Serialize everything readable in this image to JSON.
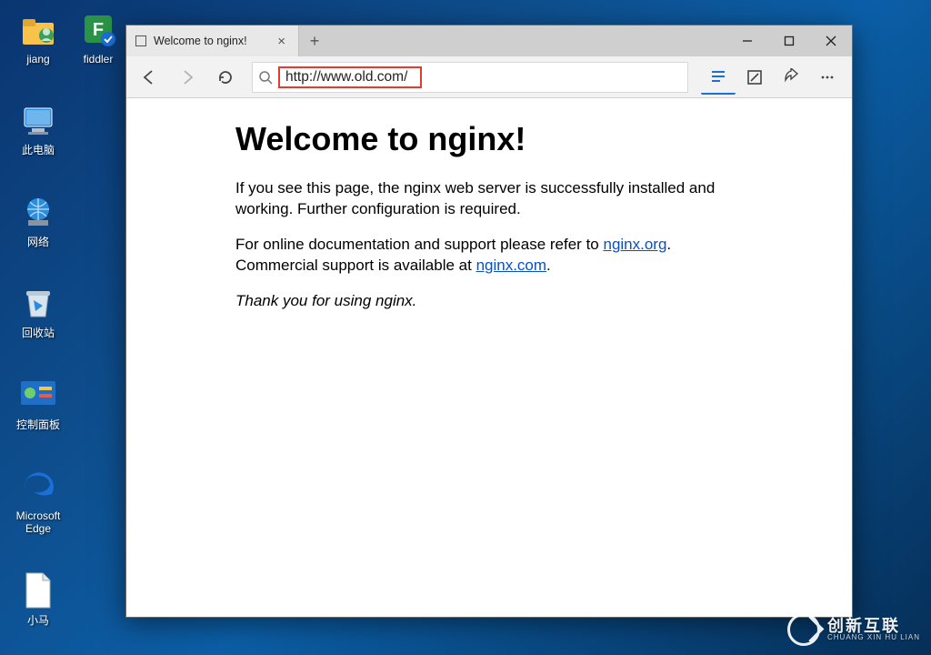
{
  "desktop": {
    "icons_col1": [
      {
        "name": "user-folder-icon",
        "label": "jiang"
      },
      {
        "name": "this-pc-icon",
        "label": "此电脑"
      },
      {
        "name": "network-icon",
        "label": "网络"
      },
      {
        "name": "recycle-bin-icon",
        "label": "回收站"
      },
      {
        "name": "control-panel-icon",
        "label": "控制面板"
      },
      {
        "name": "edge-icon",
        "label": "Microsoft Edge"
      },
      {
        "name": "file-icon",
        "label": "小马"
      }
    ],
    "icons_col2": [
      {
        "name": "fiddler-icon",
        "label": "fiddler"
      }
    ]
  },
  "browser": {
    "tab_title": "Welcome to nginx!",
    "url": "http://www.old.com/",
    "toolbar": {
      "reading_view": "reading-view",
      "notes": "notes",
      "share": "share",
      "more": "more"
    }
  },
  "page": {
    "heading": "Welcome to nginx!",
    "p1": "If you see this page, the nginx web server is successfully installed and working. Further configuration is required.",
    "p2a": "For online documentation and support please refer to ",
    "link1": "nginx.org",
    "p2b": ".",
    "p3a": "Commercial support is available at ",
    "link2": "nginx.com",
    "p3b": ".",
    "thanks": "Thank you for using nginx."
  },
  "watermark": {
    "big": "创新互联",
    "small": "CHUANG XIN HU LIAN"
  }
}
